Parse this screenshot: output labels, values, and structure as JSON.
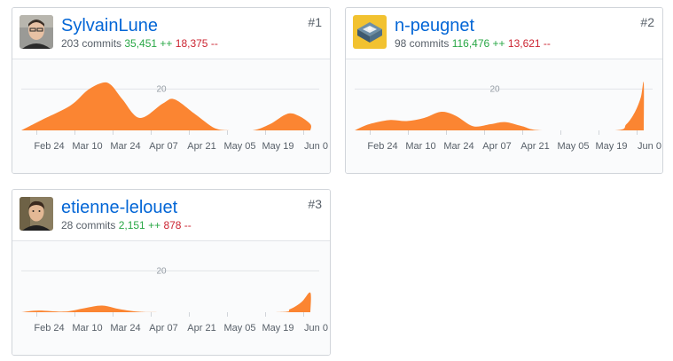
{
  "x_ticks": [
    "Feb 24",
    "Mar 10",
    "Mar 24",
    "Apr 07",
    "Apr 21",
    "May 05",
    "May 19",
    "Jun 0"
  ],
  "y_gridline": "20",
  "colors": {
    "area": "#fb8532",
    "link": "#0366d6",
    "additions": "#28a745",
    "deletions": "#cb2431"
  },
  "contributors": [
    {
      "rank": "#1",
      "username": "SylvainLune",
      "commits": "203 commits",
      "additions": "35,451 ++",
      "deletions": "18,375 --",
      "avatar_icon": "person-photo-icon",
      "chart_data": {
        "type": "area",
        "x_labels": [
          "Feb 24",
          "Mar 10",
          "Mar 24",
          "Apr 07",
          "Apr 21",
          "May 05",
          "May 19",
          "Jun 0"
        ],
        "gridline": 20,
        "ylim": [
          0,
          30
        ],
        "points": [
          [
            0,
            0
          ],
          [
            0.07,
            5
          ],
          [
            0.17,
            12
          ],
          [
            0.23,
            19.5
          ],
          [
            0.28,
            23
          ],
          [
            0.31,
            22
          ],
          [
            0.35,
            15
          ],
          [
            0.41,
            6
          ],
          [
            0.49,
            13
          ],
          [
            0.53,
            15
          ],
          [
            0.6,
            8
          ],
          [
            0.67,
            1
          ],
          [
            0.72,
            0
          ],
          [
            0.8,
            0
          ],
          [
            0.86,
            3
          ],
          [
            0.92,
            8
          ],
          [
            0.96,
            7
          ],
          [
            1,
            3
          ],
          [
            1,
            0
          ]
        ]
      }
    },
    {
      "rank": "#2",
      "username": "n-peugnet",
      "commits": "98 commits",
      "additions": "116,476 ++",
      "deletions": "13,621 --",
      "avatar_icon": "building-avatar-icon",
      "chart_data": {
        "type": "area",
        "x_labels": [
          "Feb 24",
          "Mar 10",
          "Mar 24",
          "Apr 07",
          "Apr 21",
          "May 05",
          "May 19",
          "Jun 0"
        ],
        "gridline": 20,
        "ylim": [
          0,
          30
        ],
        "points": [
          [
            0,
            0
          ],
          [
            0.05,
            3
          ],
          [
            0.12,
            5
          ],
          [
            0.18,
            4.5
          ],
          [
            0.24,
            6
          ],
          [
            0.3,
            9
          ],
          [
            0.35,
            7
          ],
          [
            0.41,
            2
          ],
          [
            0.47,
            3
          ],
          [
            0.52,
            4
          ],
          [
            0.58,
            2
          ],
          [
            0.65,
            0
          ],
          [
            0.9,
            0
          ],
          [
            0.94,
            3
          ],
          [
            0.97,
            9
          ],
          [
            0.99,
            16
          ],
          [
            1,
            23
          ],
          [
            1,
            0
          ]
        ]
      }
    },
    {
      "rank": "#3",
      "username": "etienne-lelouet",
      "commits": "28 commits",
      "additions": "2,151 ++",
      "deletions": "878 --",
      "avatar_icon": "person-photo-icon",
      "chart_data": {
        "type": "area",
        "x_labels": [
          "Feb 24",
          "Mar 10",
          "Mar 24",
          "Apr 07",
          "Apr 21",
          "May 05",
          "May 19",
          "Jun 0"
        ],
        "gridline": 20,
        "ylim": [
          0,
          30
        ],
        "points": [
          [
            0,
            0
          ],
          [
            0.06,
            0.8
          ],
          [
            0.15,
            0.3
          ],
          [
            0.22,
            2
          ],
          [
            0.28,
            3.2
          ],
          [
            0.34,
            1.5
          ],
          [
            0.41,
            0.2
          ],
          [
            0.5,
            0
          ],
          [
            0.88,
            0
          ],
          [
            0.93,
            1.5
          ],
          [
            0.97,
            5
          ],
          [
            1,
            9.5
          ],
          [
            1,
            0
          ]
        ]
      }
    }
  ]
}
